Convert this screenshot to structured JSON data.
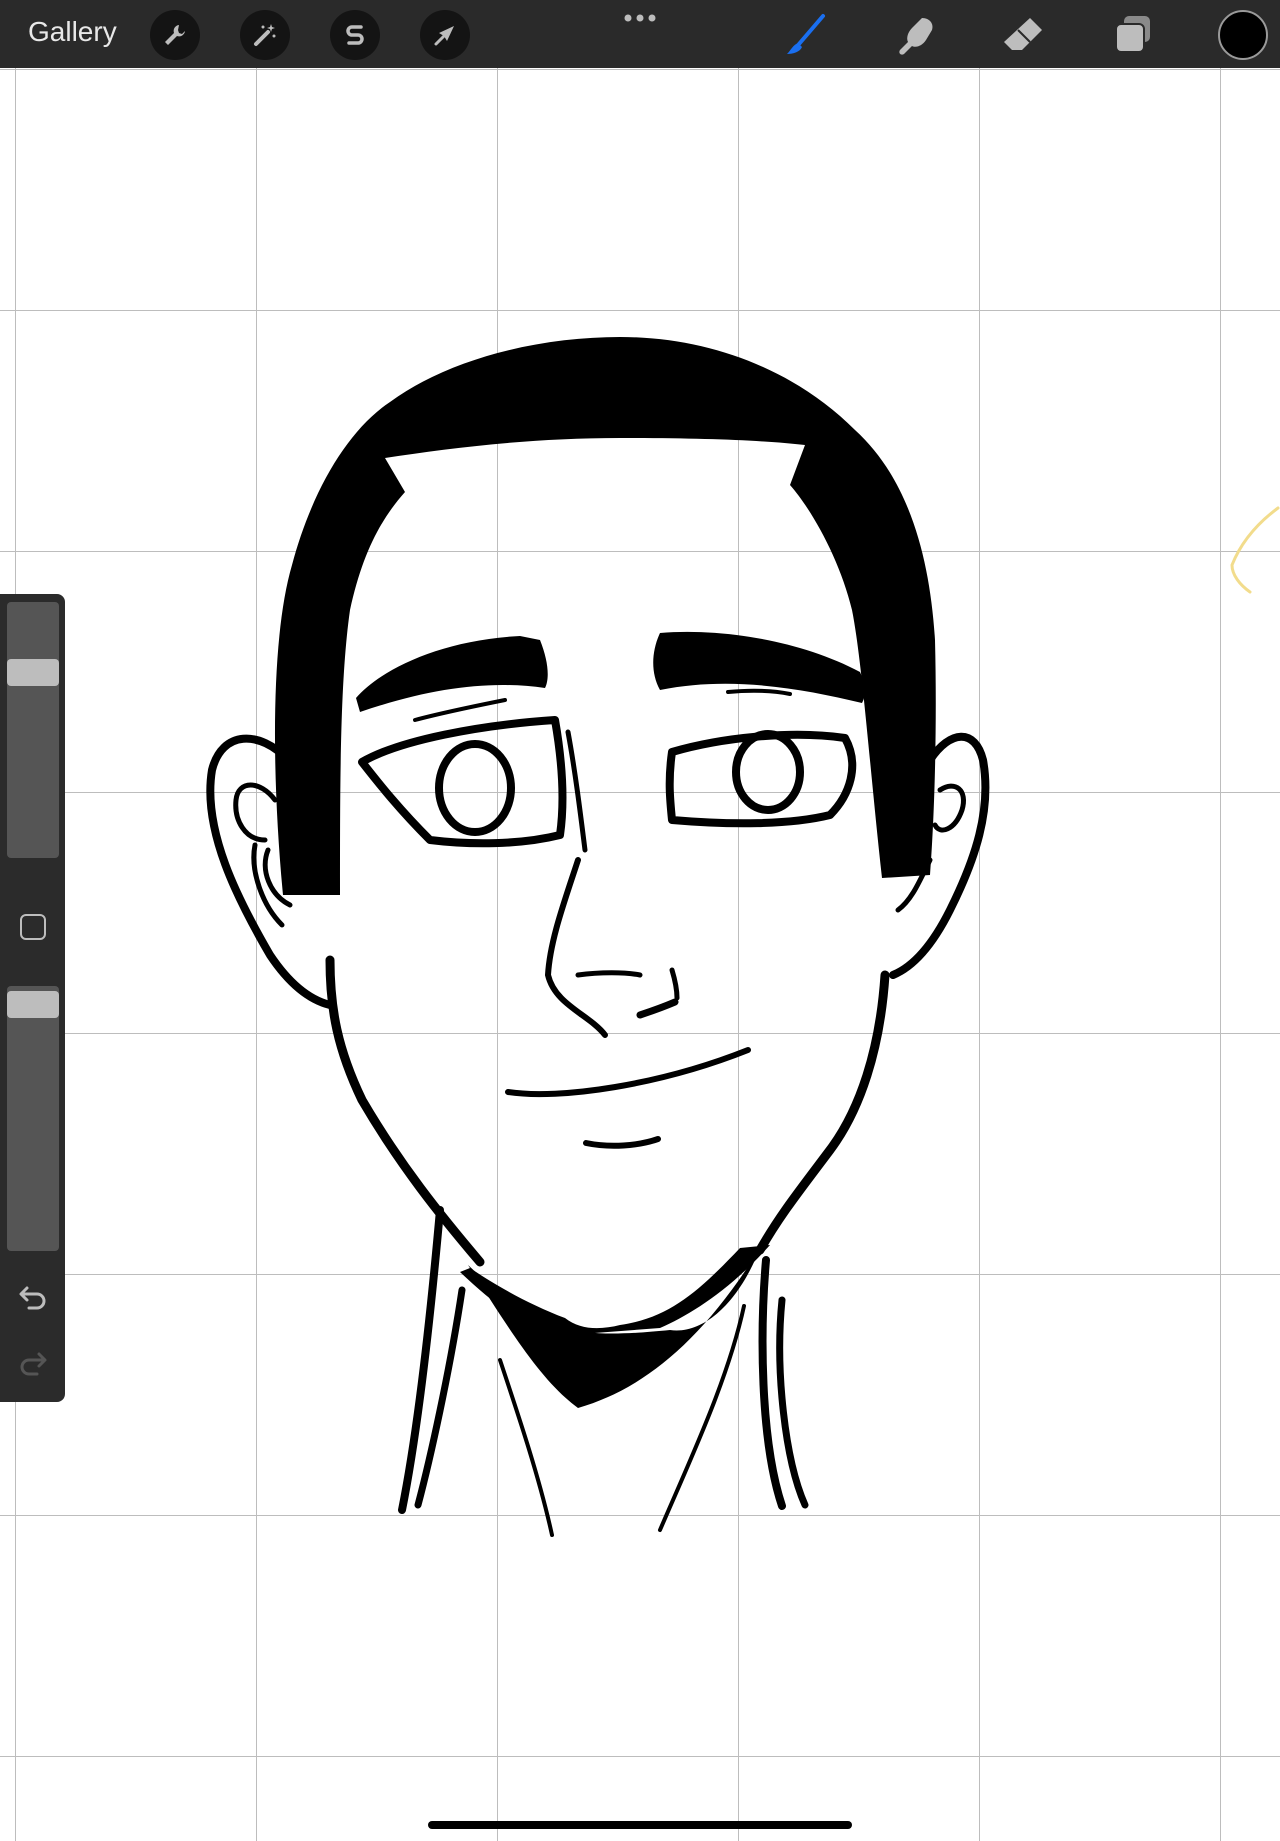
{
  "toolbar": {
    "gallery_label": "Gallery",
    "left_tools": [
      {
        "name": "actions",
        "icon": "wrench-icon"
      },
      {
        "name": "adjustments",
        "icon": "magic-wand-icon"
      },
      {
        "name": "selection",
        "icon": "selection-s-icon"
      },
      {
        "name": "transform",
        "icon": "arrow-cursor-icon"
      }
    ],
    "more_icon": "more-dots-icon",
    "right_tools": [
      {
        "name": "brush",
        "icon": "brush-icon",
        "active": true
      },
      {
        "name": "smudge",
        "icon": "smudge-finger-icon",
        "active": false
      },
      {
        "name": "eraser",
        "icon": "eraser-icon",
        "active": false
      },
      {
        "name": "layers",
        "icon": "layers-icon",
        "active": false
      }
    ],
    "current_color": "#000000"
  },
  "sidebar": {
    "brush_size_level": 0.75,
    "opacity_level": 0.98,
    "modify_icon": "square-modify-icon",
    "undo_icon": "undo-arrow-icon",
    "redo_icon": "redo-arrow-icon"
  },
  "colors": {
    "active_tool": "#1a6ff0",
    "toolbar_bg": "#2a2a2a",
    "icon": "#bdbdbd",
    "grid": "#bdbdbd",
    "ink": "#000000",
    "stray_stroke": "#f2dc8c"
  }
}
